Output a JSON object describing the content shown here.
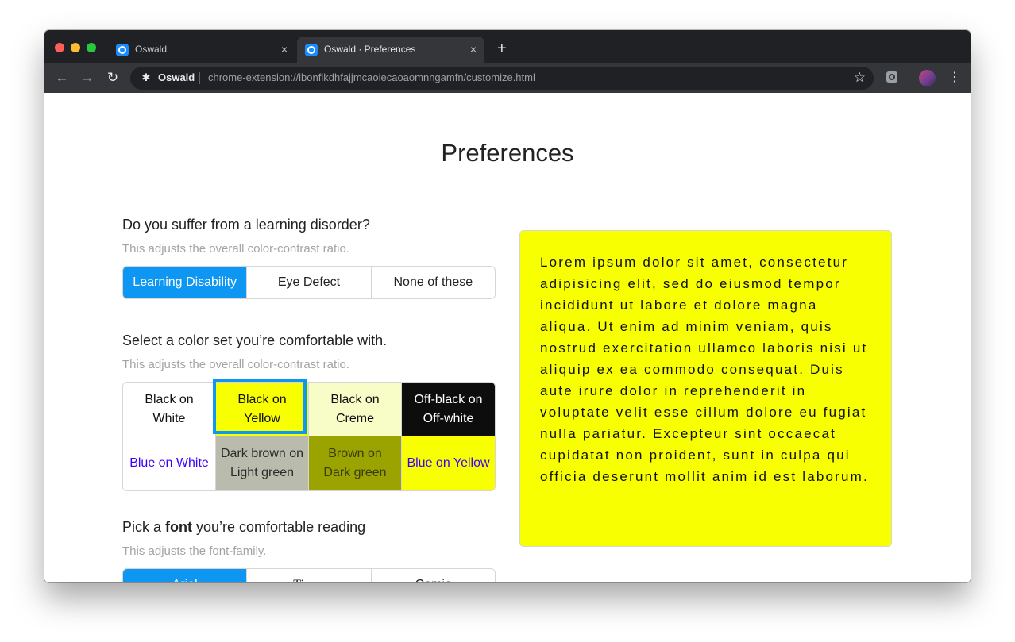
{
  "browser": {
    "tabs": [
      {
        "title": "Oswald",
        "close_glyph": "×"
      },
      {
        "title": "Oswald · Preferences",
        "close_glyph": "×"
      }
    ],
    "new_tab_glyph": "+",
    "back_glyph": "←",
    "forward_glyph": "→",
    "reload_glyph": "↻",
    "site_name": "Oswald",
    "url": "chrome-extension://ibonfikdhfajjmcaoiecaoaomnngamfn/customize.html",
    "star_glyph": "☆",
    "menu_glyph": "⋮",
    "extension_glyph": "✱"
  },
  "page": {
    "title": "Preferences",
    "disorder": {
      "question": "Do you suffer from a learning disorder?",
      "hint": "This adjusts the overall color-contrast ratio.",
      "options": [
        "Learning Disability",
        "Eye Defect",
        "None of these"
      ],
      "selected": "Learning Disability"
    },
    "color_set": {
      "question": "Select a color set you’re comfortable with.",
      "hint": "This adjusts the overall color-contrast ratio.",
      "options": [
        {
          "line1": "Black on",
          "line2": "White",
          "fg": "#111111",
          "bg": "#ffffff"
        },
        {
          "line1": "Black on",
          "line2": "Yellow",
          "fg": "#111111",
          "bg": "#f7ff00"
        },
        {
          "line1": "Black on",
          "line2": "Creme",
          "fg": "#111111",
          "bg": "#f8fdc8"
        },
        {
          "line1": "Off-black on",
          "line2": "Off-white",
          "fg": "#ffffff",
          "bg": "#0d0d0d"
        },
        {
          "line1": "Blue on White",
          "line2": "",
          "fg": "#3a00ff",
          "bg": "#ffffff"
        },
        {
          "line1": "Dark brown on",
          "line2": "Light green",
          "fg": "#2b2b2b",
          "bg": "#b9bcad"
        },
        {
          "line1": "Brown on",
          "line2": "Dark green",
          "fg": "#3b3b10",
          "bg": "#9ba300"
        },
        {
          "line1": "Blue on Yellow",
          "line2": "",
          "fg": "#3a00ff",
          "bg": "#f7ff00"
        }
      ],
      "selected": "Black on Yellow",
      "accent": "#0d96f2"
    },
    "font": {
      "question_pre": "Pick a ",
      "question_bold": "font",
      "question_post": " you’re comfortable reading",
      "hint": "This adjusts the font-family.",
      "options": [
        "Arial",
        "Times",
        "Comic"
      ],
      "selected": "Arial"
    },
    "preview": {
      "text": "Lorem ipsum dolor sit amet, consectetur adipisicing elit, sed do eiusmod tempor incididunt ut labore et dolore magna aliqua. Ut enim ad minim veniam, quis nostrud exercitation ullamco laboris nisi ut aliquip ex ea commodo consequat. Duis aute irure dolor in reprehenderit in voluptate velit esse cillum dolore eu fugiat nulla pariatur. Excepteur sint occaecat cupidatat non proident, sunt in culpa qui officia deserunt mollit anim id est laborum.",
      "bg": "#f7ff00"
    }
  }
}
